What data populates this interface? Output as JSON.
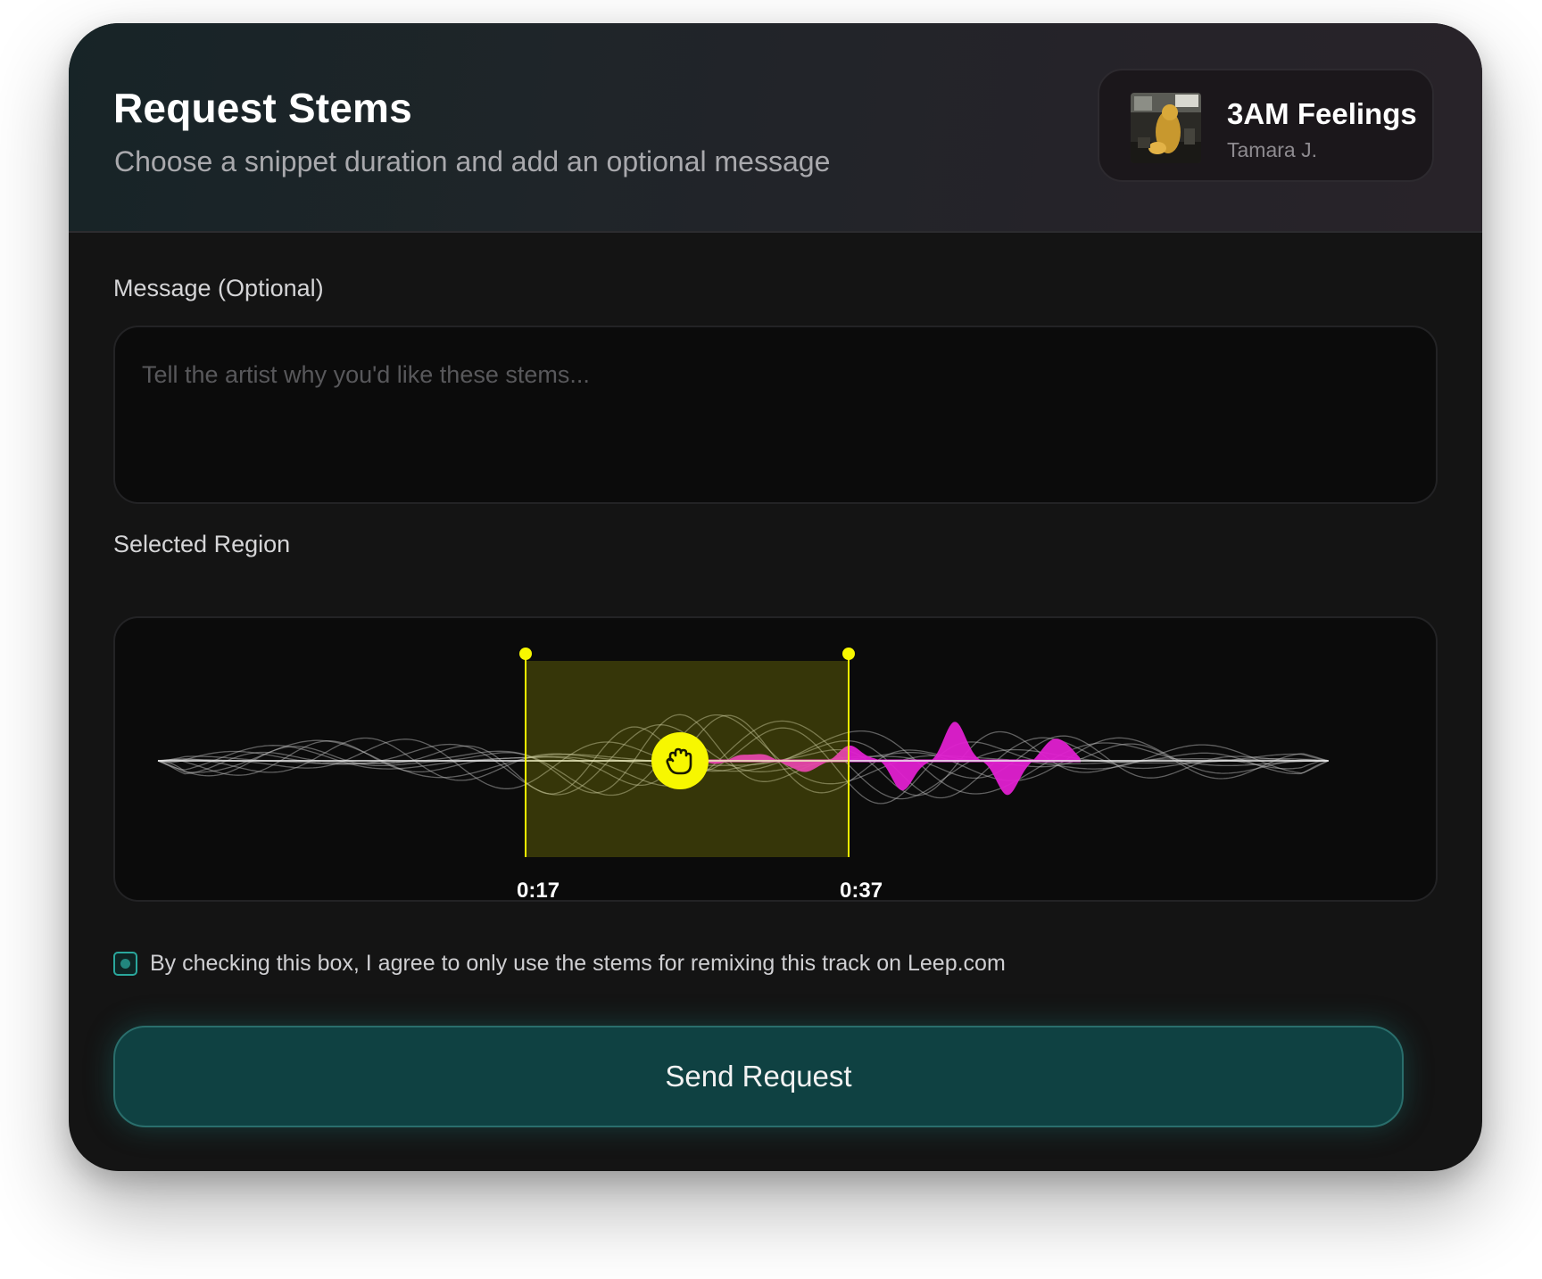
{
  "header": {
    "title": "Request Stems",
    "subtitle": "Choose a snippet duration and add an optional message"
  },
  "track": {
    "title": "3AM Feelings",
    "artist": "Tamara J."
  },
  "message": {
    "label": "Message (Optional)",
    "placeholder": "Tell the artist why you'd like these stems...",
    "value": ""
  },
  "region": {
    "label": "Selected Region",
    "start_time": "0:17",
    "end_time": "0:37",
    "drag_handle_icon": "grab-hand-icon"
  },
  "agreement": {
    "checked": true,
    "text": "By checking this box, I agree to only use the stems for remixing this track on Leep.com"
  },
  "send_button_label": "Send Request",
  "colors": {
    "accent_teal": "#0f4142",
    "selection_yellow": "#f7f700",
    "waveform_magenta": "#e020d0",
    "waveform_gray": "#bfbfbf"
  }
}
